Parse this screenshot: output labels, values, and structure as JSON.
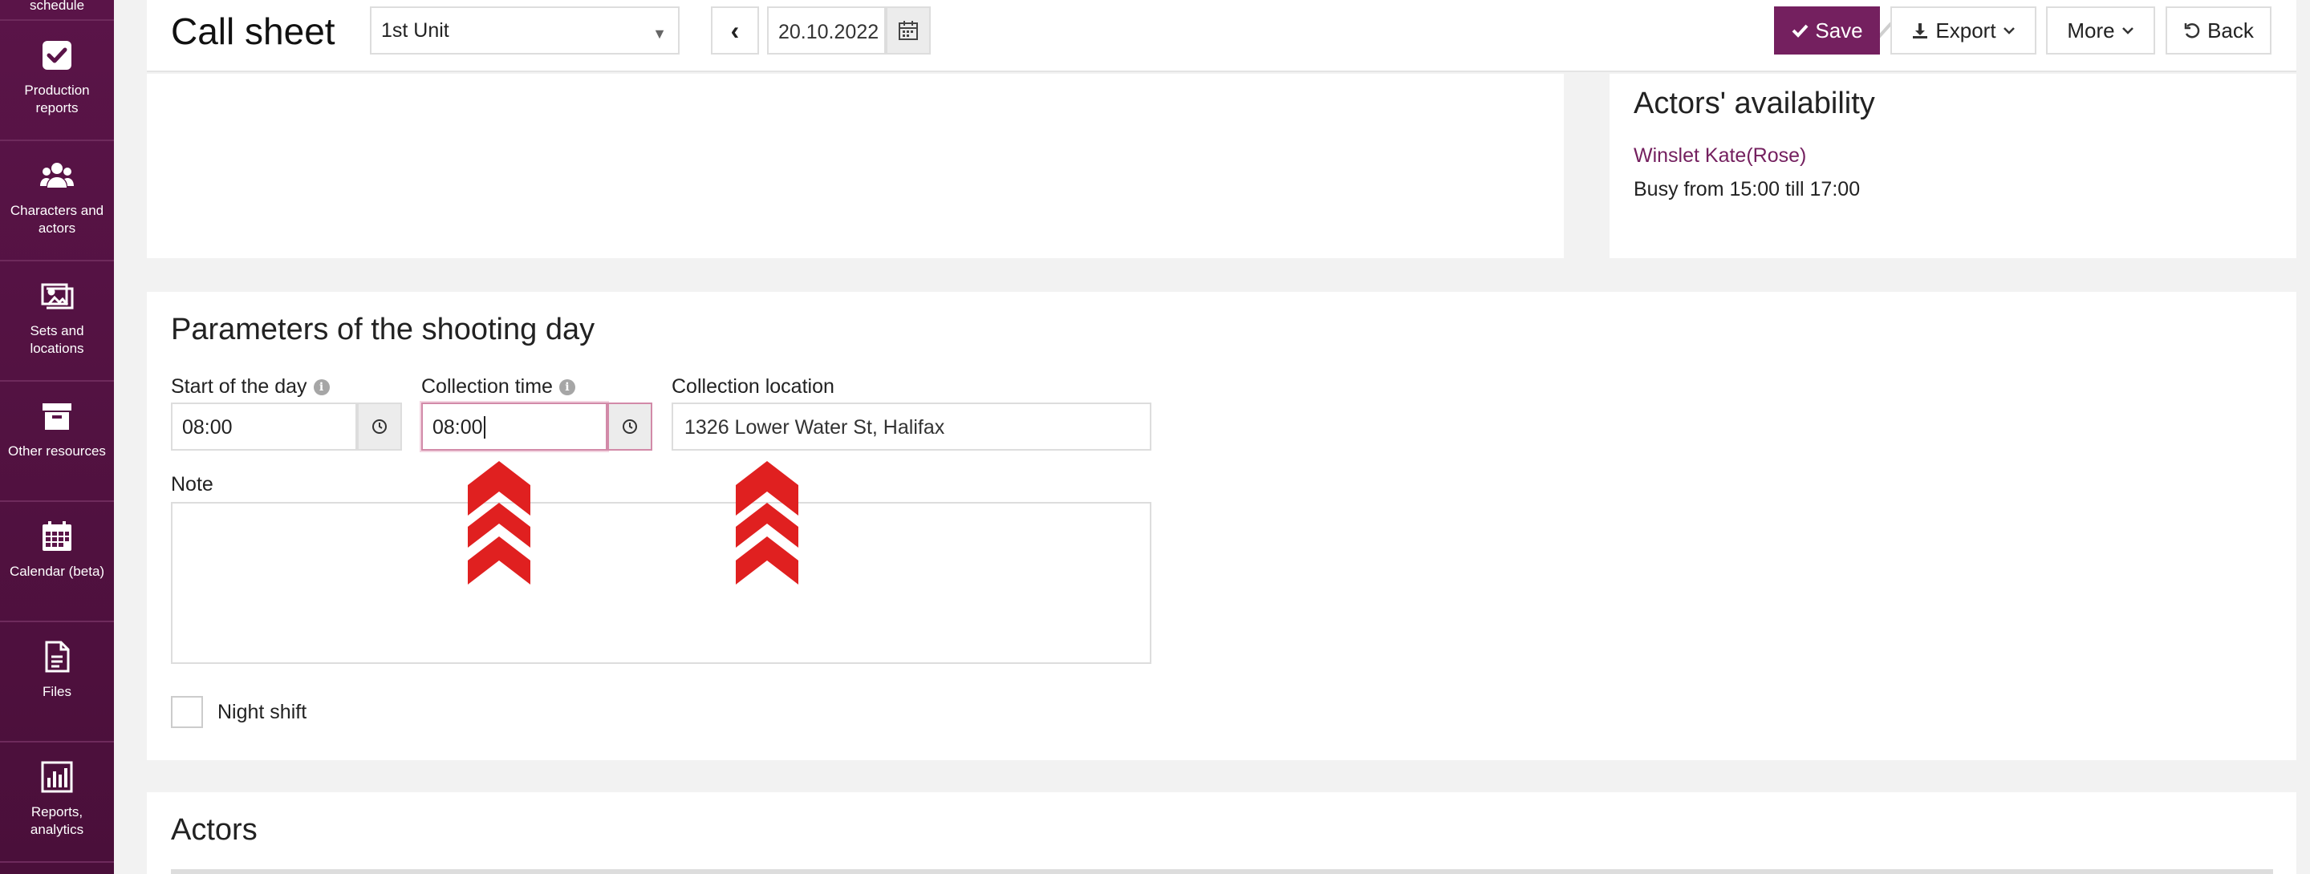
{
  "sidebar": {
    "items": [
      {
        "label": "schedule",
        "icon": "calendar-list-icon"
      },
      {
        "label": "Production reports",
        "icon": "checkbox-icon"
      },
      {
        "label": "Characters and actors",
        "icon": "users-icon"
      },
      {
        "label": "Sets and locations",
        "icon": "image-icon"
      },
      {
        "label": "Other resources",
        "icon": "archive-icon"
      },
      {
        "label": "Calendar (beta)",
        "icon": "calendar-icon"
      },
      {
        "label": "Files",
        "icon": "file-icon"
      },
      {
        "label": "Reports, analytics",
        "icon": "chart-icon"
      }
    ]
  },
  "header": {
    "title": "Call sheet",
    "unit_select": "1st Unit",
    "date": "20.10.2022",
    "save_label": "Save",
    "export_label": "Export",
    "more_label": "More",
    "back_label": "Back"
  },
  "availability": {
    "title": "Actors' availability",
    "actor": "Winslet Kate(Rose)",
    "busy": "Busy from 15:00 till 17:00"
  },
  "params": {
    "title": "Parameters of the shooting day",
    "start_label": "Start of the day",
    "start_value": "08:00",
    "collection_time_label": "Collection time",
    "collection_time_value": "08:00",
    "collection_location_label": "Collection location",
    "collection_location_value": "1326 Lower Water St, Halifax",
    "note_label": "Note",
    "night_shift_label": "Night shift"
  },
  "actors": {
    "title": "Actors"
  },
  "colors": {
    "sidebar": "#5a1448",
    "accent": "#74205f",
    "arrow": "#e02020"
  }
}
